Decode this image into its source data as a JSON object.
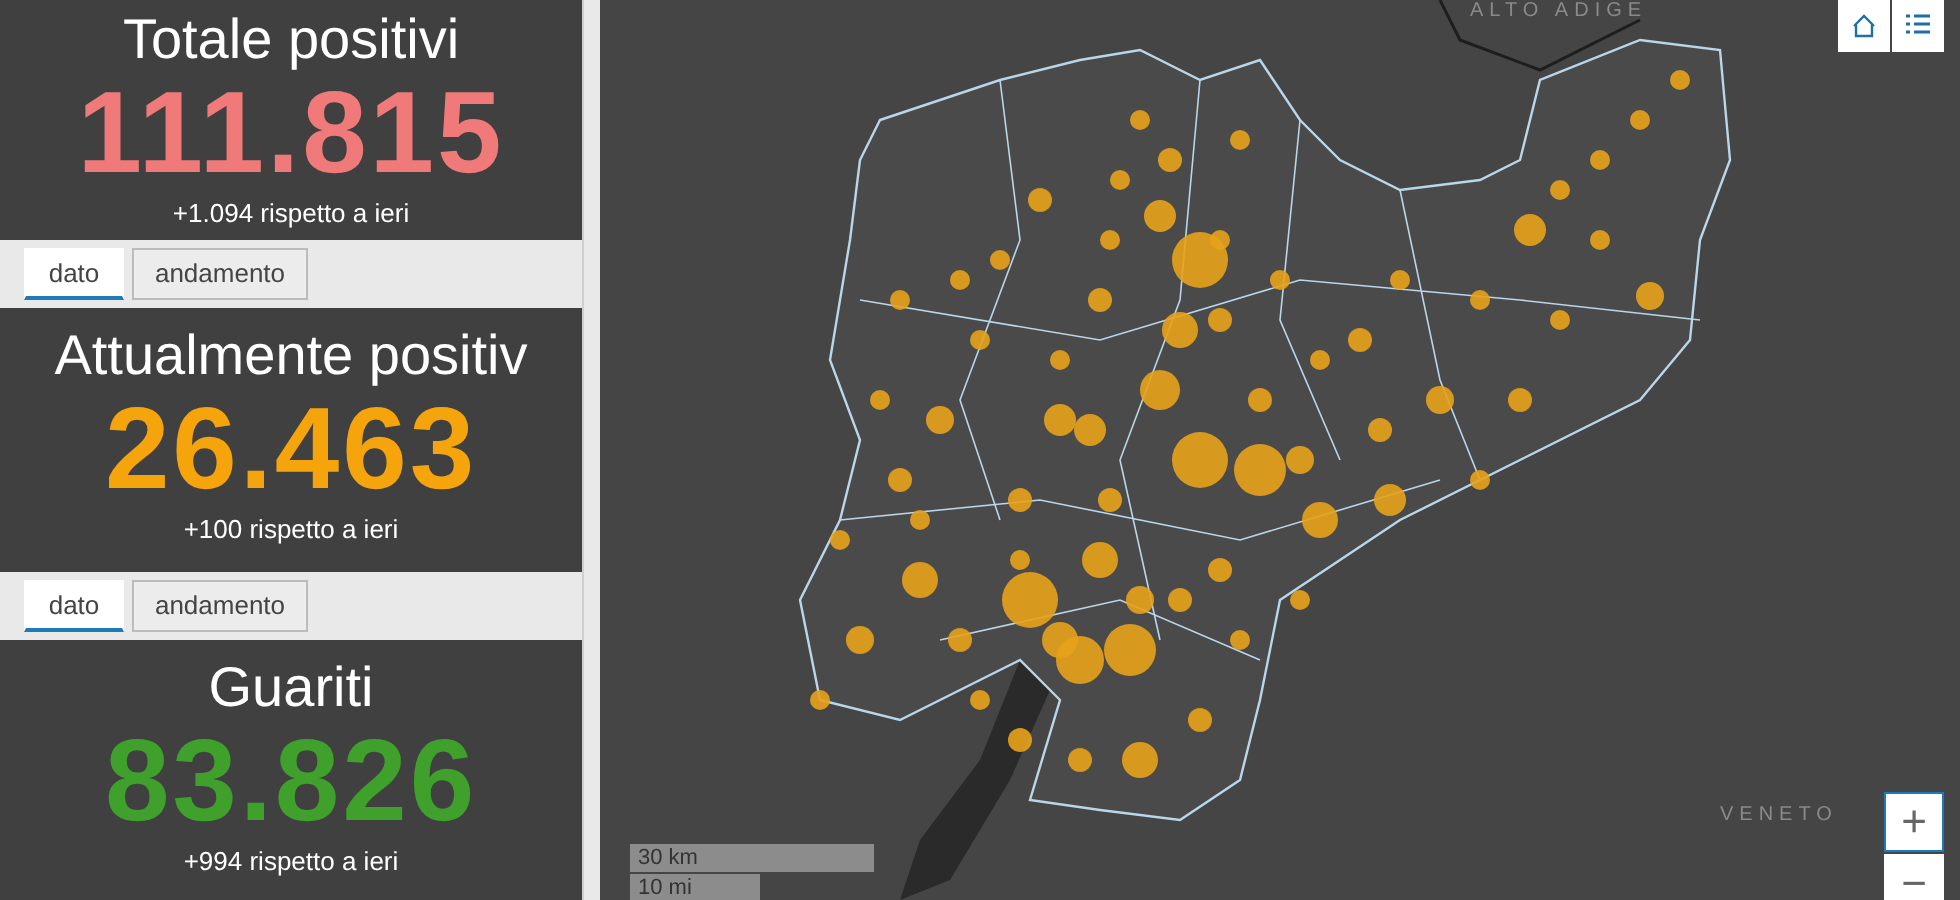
{
  "stats": [
    {
      "title": "Totale positivi",
      "value": "111.815",
      "delta": "+1.094 rispetto a ieri",
      "color": "#f07a7a",
      "tabs": [
        {
          "label": "dato",
          "selected": true
        },
        {
          "label": "andamento",
          "selected": false
        }
      ]
    },
    {
      "title": "Attualmente positiv",
      "value": "26.463",
      "delta": "+100 rispetto a ieri",
      "color": "#f5a40c",
      "tabs": [
        {
          "label": "dato",
          "selected": true
        },
        {
          "label": "andamento",
          "selected": false
        }
      ]
    },
    {
      "title": "Guariti",
      "value": "83.826",
      "delta": "+994 rispetto a ieri",
      "color": "#3fa12b"
    }
  ],
  "map": {
    "labels": [
      "ALTO ADIGE",
      "VENETO"
    ],
    "scale": [
      "30 km",
      "10 mi"
    ],
    "zoom_in": "+",
    "zoom_out": "−"
  }
}
